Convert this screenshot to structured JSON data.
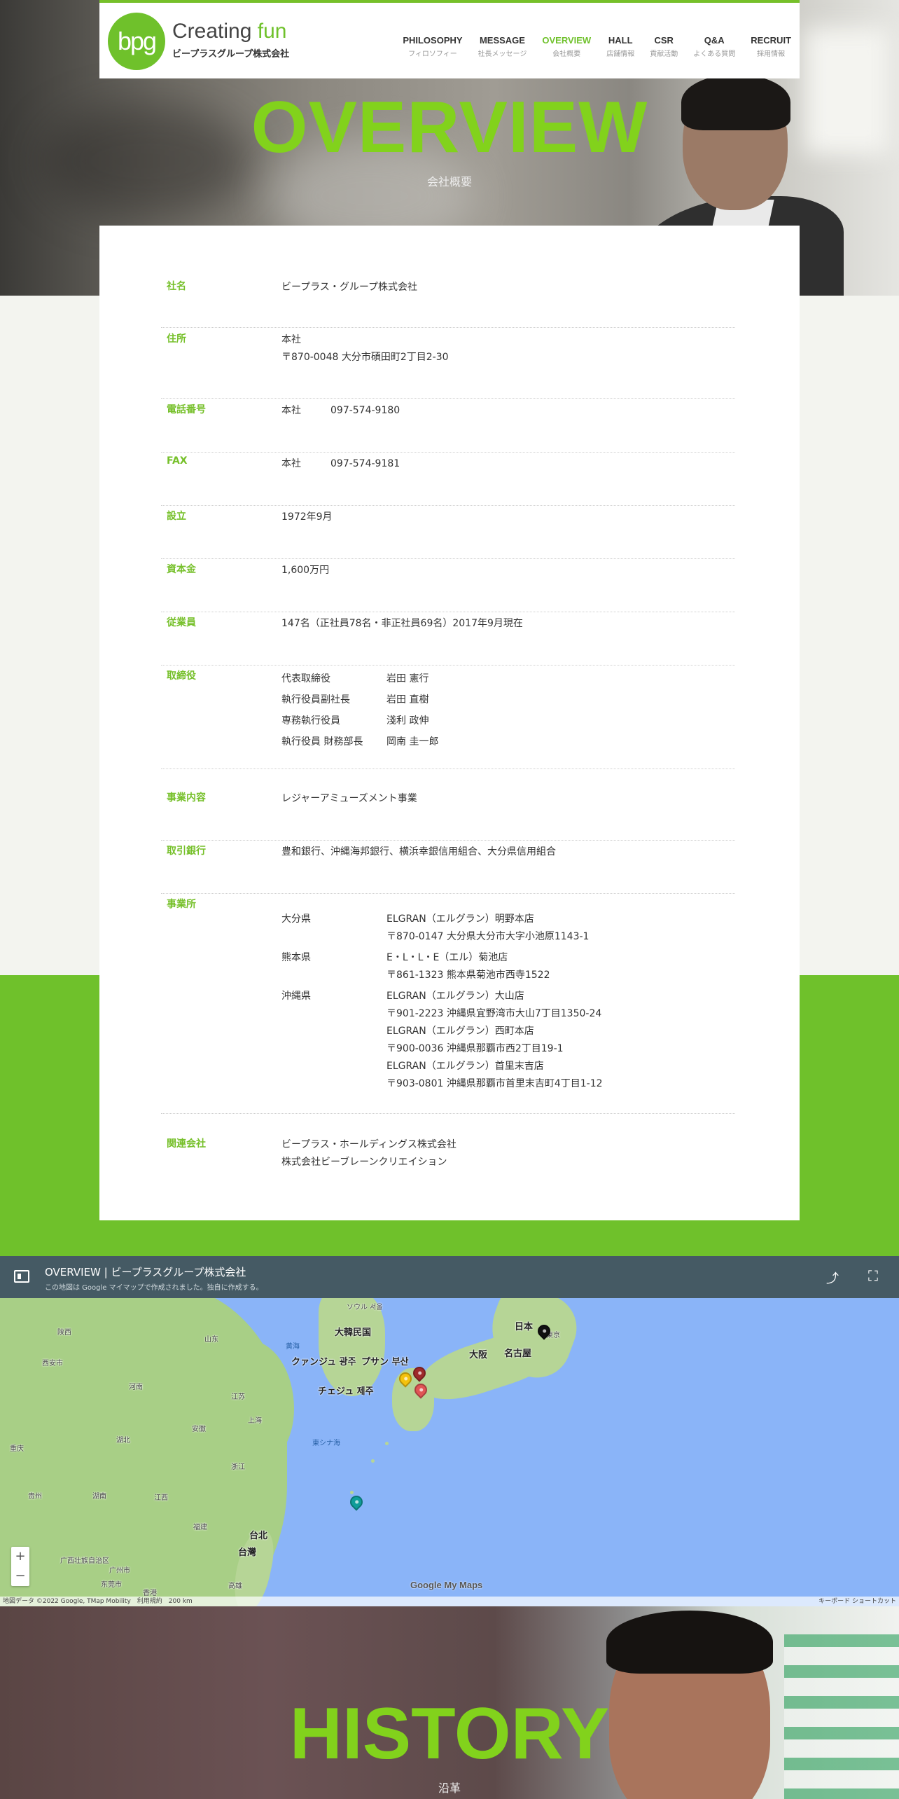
{
  "header": {
    "logo_mark": "bpg",
    "logo_text_a": "Creating",
    "logo_text_b": "fun",
    "logo_sub": "ビープラスグループ株式会社",
    "nav": [
      {
        "en": "PHILOSOPHY",
        "ja": "フィロソフィー"
      },
      {
        "en": "MESSAGE",
        "ja": "社長メッセージ"
      },
      {
        "en": "OVERVIEW",
        "ja": "会社概要",
        "active": true
      },
      {
        "en": "HALL",
        "ja": "店舗情報"
      },
      {
        "en": "CSR",
        "ja": "貢献活動"
      },
      {
        "en": "Q&A",
        "ja": "よくある質問"
      },
      {
        "en": "RECRUIT",
        "ja": "採用情報"
      }
    ],
    "active_color": "#6fc12b"
  },
  "hero": {
    "title": "OVERVIEW",
    "subtitle": "会社概要"
  },
  "overview": {
    "company": {
      "label": "社名",
      "value": "ビープラス・グループ株式会社"
    },
    "address": {
      "label": "住所",
      "line1": "本社",
      "line2": "〒870-0048 大分市碩田町2丁目2-30"
    },
    "phone": {
      "label": "電話番号",
      "k": "本社",
      "v": "097-574-9180"
    },
    "fax": {
      "label": "FAX",
      "k": "本社",
      "v": "097-574-9181"
    },
    "founded": {
      "label": "設立",
      "value": "1972年9月"
    },
    "capital": {
      "label": "資本金",
      "value": "1,600万円"
    },
    "employees": {
      "label": "従業員",
      "value": "147名（正社員78名・非正社員69名）2017年9月現在"
    },
    "officers": {
      "label": "取締役",
      "items": [
        {
          "role": "代表取締役",
          "name": "岩田 憲行"
        },
        {
          "role": "執行役員副社長",
          "name": "岩田 直樹"
        },
        {
          "role": "専務執行役員",
          "name": "淺利 政伸"
        },
        {
          "role": "執行役員 財務部長",
          "name": "岡南 圭一郎"
        }
      ]
    },
    "business": {
      "label": "事業内容",
      "value": "レジャーアミューズメント事業"
    },
    "banks": {
      "label": "取引銀行",
      "value": "豊和銀行、沖縄海邦銀行、横浜幸銀信用組合、大分県信用組合"
    },
    "offices": {
      "label": "事業所",
      "groups": [
        {
          "pref": "大分県",
          "lines": [
            "ELGRAN（エルグラン）明野本店",
            "〒870-0147 大分県大分市大字小池原1143-1"
          ]
        },
        {
          "pref": "熊本県",
          "lines": [
            "E・L・L・E（エル）菊池店",
            "〒861-1323 熊本県菊池市西寺1522"
          ]
        },
        {
          "pref": "沖縄県",
          "lines": [
            "ELGRAN（エルグラン）大山店",
            "〒901-2223 沖縄県宜野湾市大山7丁目1350-24",
            "ELGRAN（エルグラン）西町本店",
            "〒900-0036 沖縄県那覇市西2丁目19-1",
            "ELGRAN（エルグラン）首里末吉店",
            "〒903-0801 沖縄県那覇市首里末吉町4丁目1-12"
          ]
        }
      ]
    },
    "related": {
      "label": "関連会社",
      "line1": "ビープラス・ホールディングス株式会社",
      "line2": "株式会社ビーブレーンクリエイション"
    }
  },
  "map": {
    "title": "OVERVIEW | ビープラスグループ株式会社",
    "note": "この地図は Google マイマップで作成されました。独自に作成する。",
    "labels": {
      "korea": "大韓民国",
      "seoul": "ソウル 서울",
      "japan": "日本",
      "tokyo": "東京",
      "osaka": "大阪",
      "nagoya": "名古屋",
      "gwangju": "クァンジュ 광주",
      "busan": "プサン 부산",
      "jeju": "チェジュ 제주",
      "taipei": "台北",
      "taiwan": "台灣",
      "kaohsiung": "高雄",
      "shanghai": "上海",
      "xian": "西安市",
      "chongqing": "重庆",
      "guangzhou": "广州市",
      "dongguan": "东莞市",
      "hongkong": "香港",
      "east_sea": "東シナ海",
      "yellow_sea": "黄海",
      "jiangsu": "江苏",
      "zhejiang": "浙江",
      "henan": "河南",
      "shandong": "山东",
      "anhui": "安徽",
      "hubei": "湖北",
      "hunan": "湖南",
      "jiangxi": "江西",
      "fujian": "福建",
      "shanxi": "陕西",
      "guizhou": "贵州",
      "guangxi": "广西壮族自治区"
    },
    "logo": "Google My Maps",
    "credits": "地図データ ©2022 Google, TMap Mobility　利用規約　200 km",
    "kbd": "キーボード ショートカット",
    "zoom_in": "+",
    "zoom_out": "−",
    "pin_colors": [
      "#111111",
      "#9e2a2b",
      "#f4c20d",
      "#e05555",
      "#0f9d9a"
    ]
  },
  "history": {
    "title": "HISTORY",
    "subtitle": "沿革"
  }
}
